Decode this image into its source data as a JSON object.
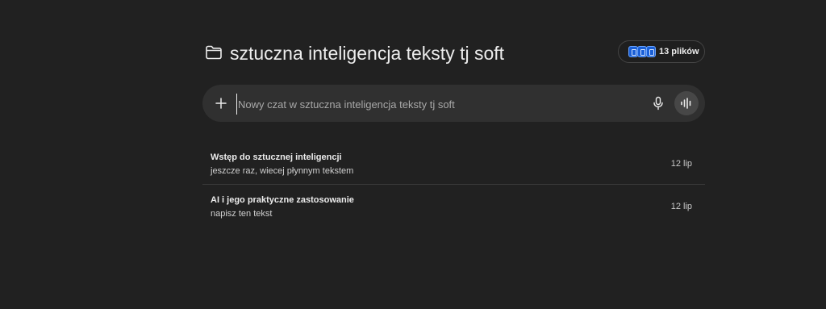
{
  "project": {
    "title": "sztuczna inteligencja teksty tj soft",
    "folder_icon": "folder-icon"
  },
  "files": {
    "count_label": "13 plików",
    "icon": "file-stack-icon",
    "accent": "#1a5fd6"
  },
  "composer": {
    "placeholder": "Nowy czat w sztuczna inteligencja teksty tj soft",
    "value": "",
    "plus_icon": "plus-icon",
    "mic_icon": "microphone-icon",
    "voice_icon": "voice-mode-icon"
  },
  "chats": [
    {
      "title": "Wstęp do sztucznej inteligencji",
      "snippet": "jeszcze raz, wiecej płynnym tekstem",
      "date": "12 lip"
    },
    {
      "title": "AI i jego praktyczne zastosowanie",
      "snippet": "napisz ten tekst",
      "date": "12 lip"
    }
  ],
  "colors": {
    "background": "#212121",
    "composer": "#303030",
    "text": "#ececec"
  }
}
